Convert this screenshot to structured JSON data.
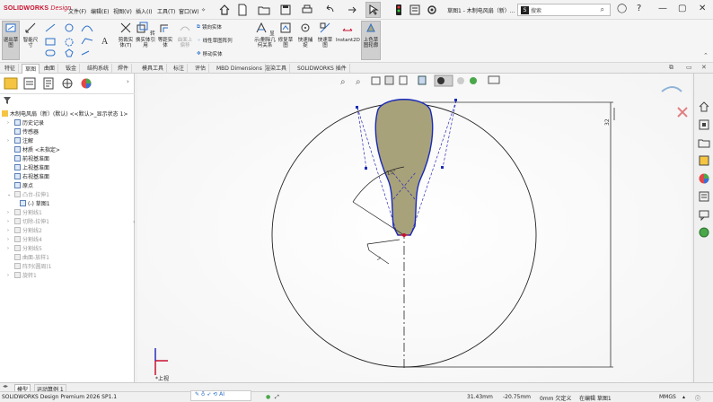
{
  "app": {
    "logo_brand": "SOLIDWORKS",
    "logo_suffix": "Design",
    "doc_title": "草图1 - 木制电风扇（新）...",
    "menus": [
      "文件(F)",
      "编辑(E)",
      "视图(V)",
      "插入(I)",
      "工具(T)",
      "窗口(W)"
    ],
    "search_placeholder": "搜索"
  },
  "ribbon": {
    "exit_sketch": "退出草图",
    "smart_dim": "智能尺寸",
    "trim": "剪裁实体(T)",
    "convert": "转换实体引用",
    "offset": "等距实体",
    "offset_surface": "曲面上偏移",
    "mirror": "镜向实体",
    "linear_pattern": "线性草图阵列",
    "move": "移动实体",
    "display_relations": "显示/删除几何关系",
    "repair": "修复草图",
    "quick_snap": "快速捕捉",
    "rapid_sketch": "快速草图",
    "instant2d": "Instant2D",
    "shaded_sketch": "上色草图轮廓"
  },
  "tabs": [
    "特征",
    "草图",
    "曲面",
    "钣金",
    "结构系统",
    "焊件",
    "模具工具",
    "标注",
    "评估",
    "MBD Dimensions",
    "渲染工具",
    "SOLIDWORKS 插件"
  ],
  "active_tab": 1,
  "tree": {
    "root": "木制电风扇（新）(默认) <<默认>_显示状态 1>",
    "items": [
      {
        "label": "历史记录",
        "gray": false,
        "arrow": "›",
        "indent": 1
      },
      {
        "label": "传感器",
        "gray": false,
        "arrow": "",
        "indent": 1
      },
      {
        "label": "注解",
        "gray": false,
        "arrow": "›",
        "indent": 1
      },
      {
        "label": "材质 <未指定>",
        "gray": false,
        "arrow": "",
        "indent": 1
      },
      {
        "label": "前视基准面",
        "gray": false,
        "arrow": "",
        "indent": 1
      },
      {
        "label": "上视基准面",
        "gray": false,
        "arrow": "",
        "indent": 1
      },
      {
        "label": "右视基准面",
        "gray": false,
        "arrow": "",
        "indent": 1
      },
      {
        "label": "原点",
        "gray": false,
        "arrow": "",
        "indent": 1
      },
      {
        "label": "凸台-拉伸1",
        "gray": true,
        "arrow": "⌄",
        "indent": 1
      },
      {
        "label": "(-) 草图1",
        "gray": false,
        "arrow": "",
        "indent": 2
      },
      {
        "label": "分割线1",
        "gray": true,
        "arrow": "›",
        "indent": 1
      },
      {
        "label": "切除-拉伸1",
        "gray": true,
        "arrow": "›",
        "indent": 1
      },
      {
        "label": "分割线2",
        "gray": true,
        "arrow": "›",
        "indent": 1
      },
      {
        "label": "分割线4",
        "gray": true,
        "arrow": "›",
        "indent": 1
      },
      {
        "label": "分割线5",
        "gray": true,
        "arrow": "›",
        "indent": 1
      },
      {
        "label": "曲面-放样1",
        "gray": true,
        "arrow": "",
        "indent": 1
      },
      {
        "label": "阵列(圆周)1",
        "gray": true,
        "arrow": "",
        "indent": 1
      },
      {
        "label": "旋转1",
        "gray": true,
        "arrow": "›",
        "indent": 1
      }
    ]
  },
  "canvas": {
    "view_label": "*上视",
    "dim_angle": "15°",
    "dim_small": "7",
    "dim_right": "32",
    "colors": {
      "blade_fill": "#a8a27a",
      "blade_stroke": "#1a2ab8",
      "construction": "#333333"
    }
  },
  "bottom_tabs": [
    "模型",
    "运动算例 1"
  ],
  "status": {
    "product": "SOLIDWORKS Design Premium 2026 SP1.1",
    "x": "31.43mm",
    "y": "-20.75mm",
    "z": "0mm 欠定义",
    "mode": "在编辑 草图1",
    "units": "MMGS"
  }
}
